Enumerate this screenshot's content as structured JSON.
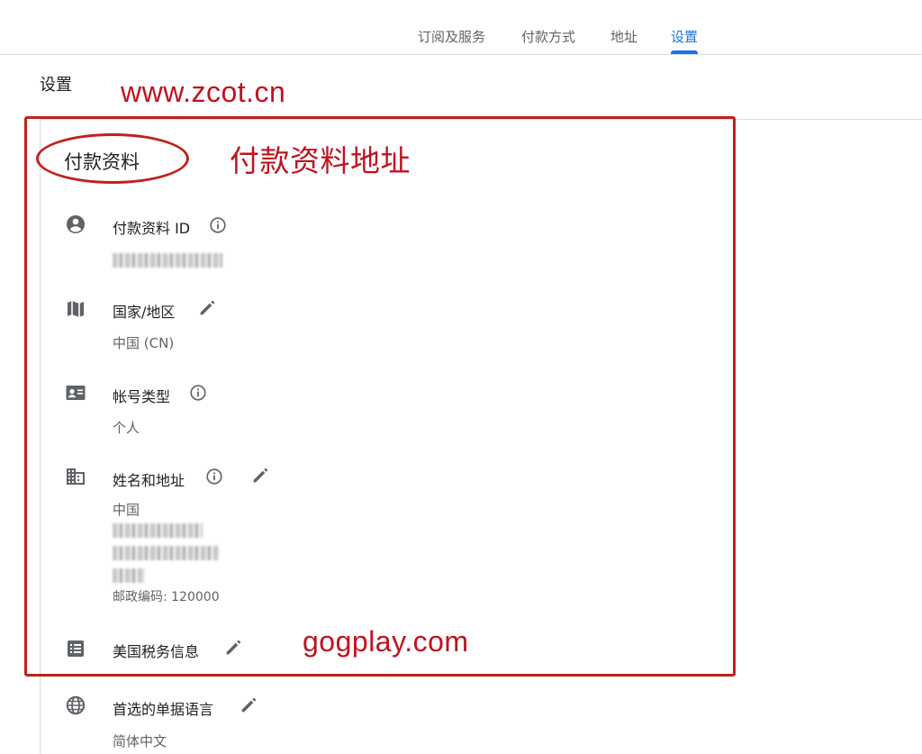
{
  "nav": {
    "tabs": [
      {
        "label": "订阅及服务",
        "active": false
      },
      {
        "label": "付款方式",
        "active": false
      },
      {
        "label": "地址",
        "active": false
      },
      {
        "label": "设置",
        "active": true
      }
    ]
  },
  "page": {
    "title": "设置"
  },
  "section": {
    "title": "付款资料"
  },
  "watermarks": {
    "top": "www.zcot.cn",
    "annotation": "付款资料地址",
    "bottom": "gogplay.com"
  },
  "rows": {
    "profile_id": {
      "label": "付款资料 ID",
      "icon": "account-circle-icon"
    },
    "country": {
      "label": "国家/地区",
      "value": "中国 (CN)",
      "icon": "map-icon"
    },
    "account_type": {
      "label": "帐号类型",
      "value": "个人",
      "icon": "contact-card-icon"
    },
    "name_address": {
      "label": "姓名和地址",
      "line1": "中国",
      "postal": "邮政编码: 120000",
      "icon": "building-icon"
    },
    "us_tax": {
      "label": "美国税务信息",
      "icon": "list-icon"
    },
    "language": {
      "label": "首选的单据语言",
      "value": "简体中文",
      "icon": "globe-icon"
    }
  },
  "colors": {
    "accent": "#1a73e8",
    "annotation": "#c0211d",
    "muted": "#5f6368"
  }
}
